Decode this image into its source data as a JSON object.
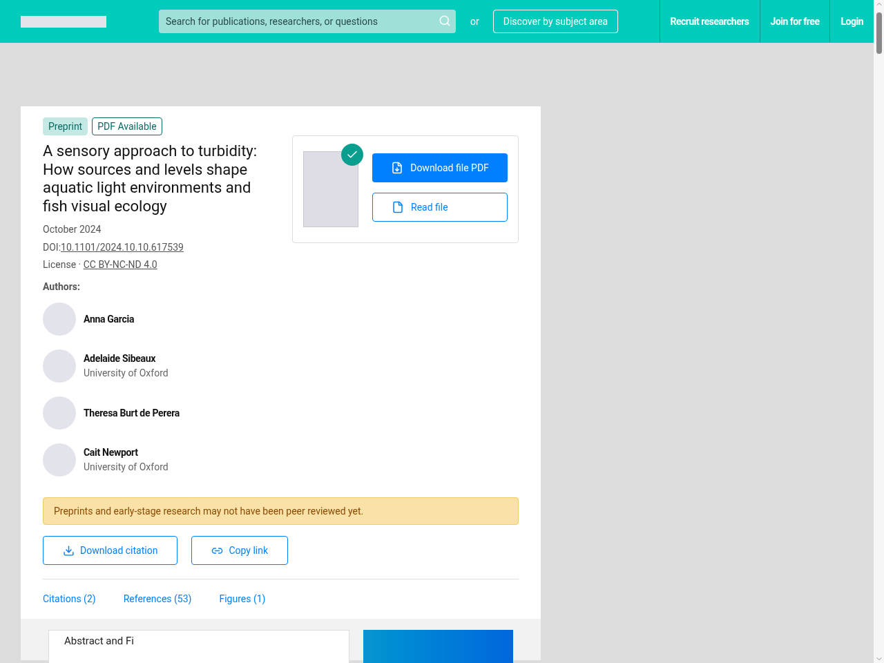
{
  "header": {
    "search": {
      "placeholder": "Search for publications, researchers, or questions"
    },
    "or_text": "or",
    "discover_button": "Discover by subject area",
    "nav": [
      "Recruit researchers",
      "Join for free",
      "Login"
    ]
  },
  "publication": {
    "badges": [
      {
        "label": "Preprint",
        "kind": "filled"
      },
      {
        "label": "PDF Available",
        "kind": "outline"
      }
    ],
    "title": "A sensory approach to turbidity: How sources and levels shape aquatic light environments and fish visual ecology",
    "date": "October 2024",
    "doi_label": "DOI:",
    "doi": "10.1101/2024.10.10.617539",
    "license_label": "License · ",
    "license": "CC BY-NC-ND 4.0",
    "authors_label": "Authors:",
    "authors": [
      {
        "name": "Anna Garcia"
      },
      {
        "name": "Adelaide Sibeaux",
        "affiliation": "University of Oxford"
      },
      {
        "name": "Theresa Burt de Perera"
      },
      {
        "name": "Cait Newport",
        "affiliation": "University of Oxford"
      }
    ],
    "file": {
      "verified": true,
      "download_button": "Download file PDF",
      "read_button": "Read file"
    },
    "notice": "Preprints and early-stage research may not have been peer reviewed yet.",
    "actions": [
      {
        "label": "Download citation",
        "kind": "download"
      },
      {
        "label": "Copy link",
        "kind": "link"
      }
    ],
    "tabs": [
      "Citations (2)",
      "References (53)",
      "Figures (1)"
    ]
  },
  "abstract_card": {
    "title": "Abstract and Fi"
  }
}
